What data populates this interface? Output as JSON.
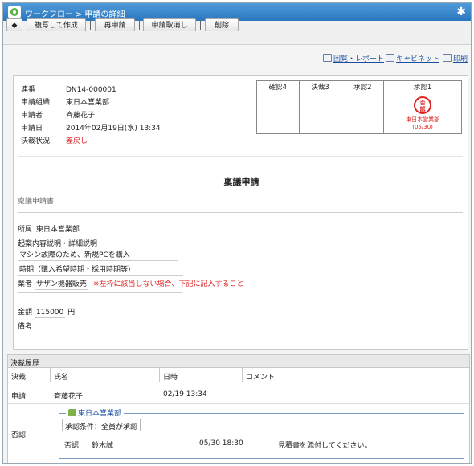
{
  "titlebar": {
    "app": "ワークフロー",
    "separator": ">",
    "page": "申請の詳細"
  },
  "toolbar": {
    "back_label": "◆",
    "copy_label": "複写して作成",
    "reapply_label": "再申請",
    "cancel_label": "申請取消し",
    "delete_label": "削除"
  },
  "links": {
    "circulate": "回覧・レポート",
    "cabinet": "キャビネット",
    "print": "印刷"
  },
  "info": {
    "number_label": "連番",
    "number_value": "DN14-000001",
    "org_label": "申請組織",
    "org_value": "東日本営業部",
    "applicant_label": "申請者",
    "applicant_value": "斉藤花子",
    "date_label": "申請日",
    "date_value": "2014年02月19日(水) 13:34",
    "status_label": "決裁状況",
    "status_value": "差戻し",
    "colon": ":"
  },
  "approval": {
    "headers": [
      "確認4",
      "決裁3",
      "承認2",
      "承認1"
    ],
    "stamp_text_top": "否",
    "stamp_text_bottom": "認",
    "stamp_dept": "東日本営業部",
    "stamp_date": "(05/30)"
  },
  "document": {
    "title": "稟議申請",
    "form_name": "稟議申請書",
    "dept_label": "所属",
    "dept_value": "東日本営業部",
    "desc_label": "起案内容説明・詳細説明",
    "desc_value": "マシン故障のため、新規PCを購入",
    "period_label": "時期（購入希望時期・採用時期等）",
    "vendor_label": "業者",
    "vendor_value": "サザン機器販売",
    "vendor_note": "※左枠に該当しない場合、下記に記入すること",
    "amount_label": "金額",
    "amount_value": "115000",
    "amount_unit": "円",
    "remarks_label": "備考"
  },
  "history": {
    "title": "決裁履歴",
    "col_decision": "決裁",
    "col_name": "氏名",
    "col_datetime": "日時",
    "col_comment": "コメント",
    "row1_decision": "申請",
    "row1_name": "斉藤花子",
    "row1_datetime": "02/19 13:34",
    "row2_decision": "否認",
    "group_name": "東日本営業部",
    "condition": "承認条件：全員が承認",
    "sub_decision": "否認",
    "sub_name": "鈴木誠",
    "sub_datetime": "05/30 18:30",
    "sub_comment": "見積書を添付してください。"
  }
}
